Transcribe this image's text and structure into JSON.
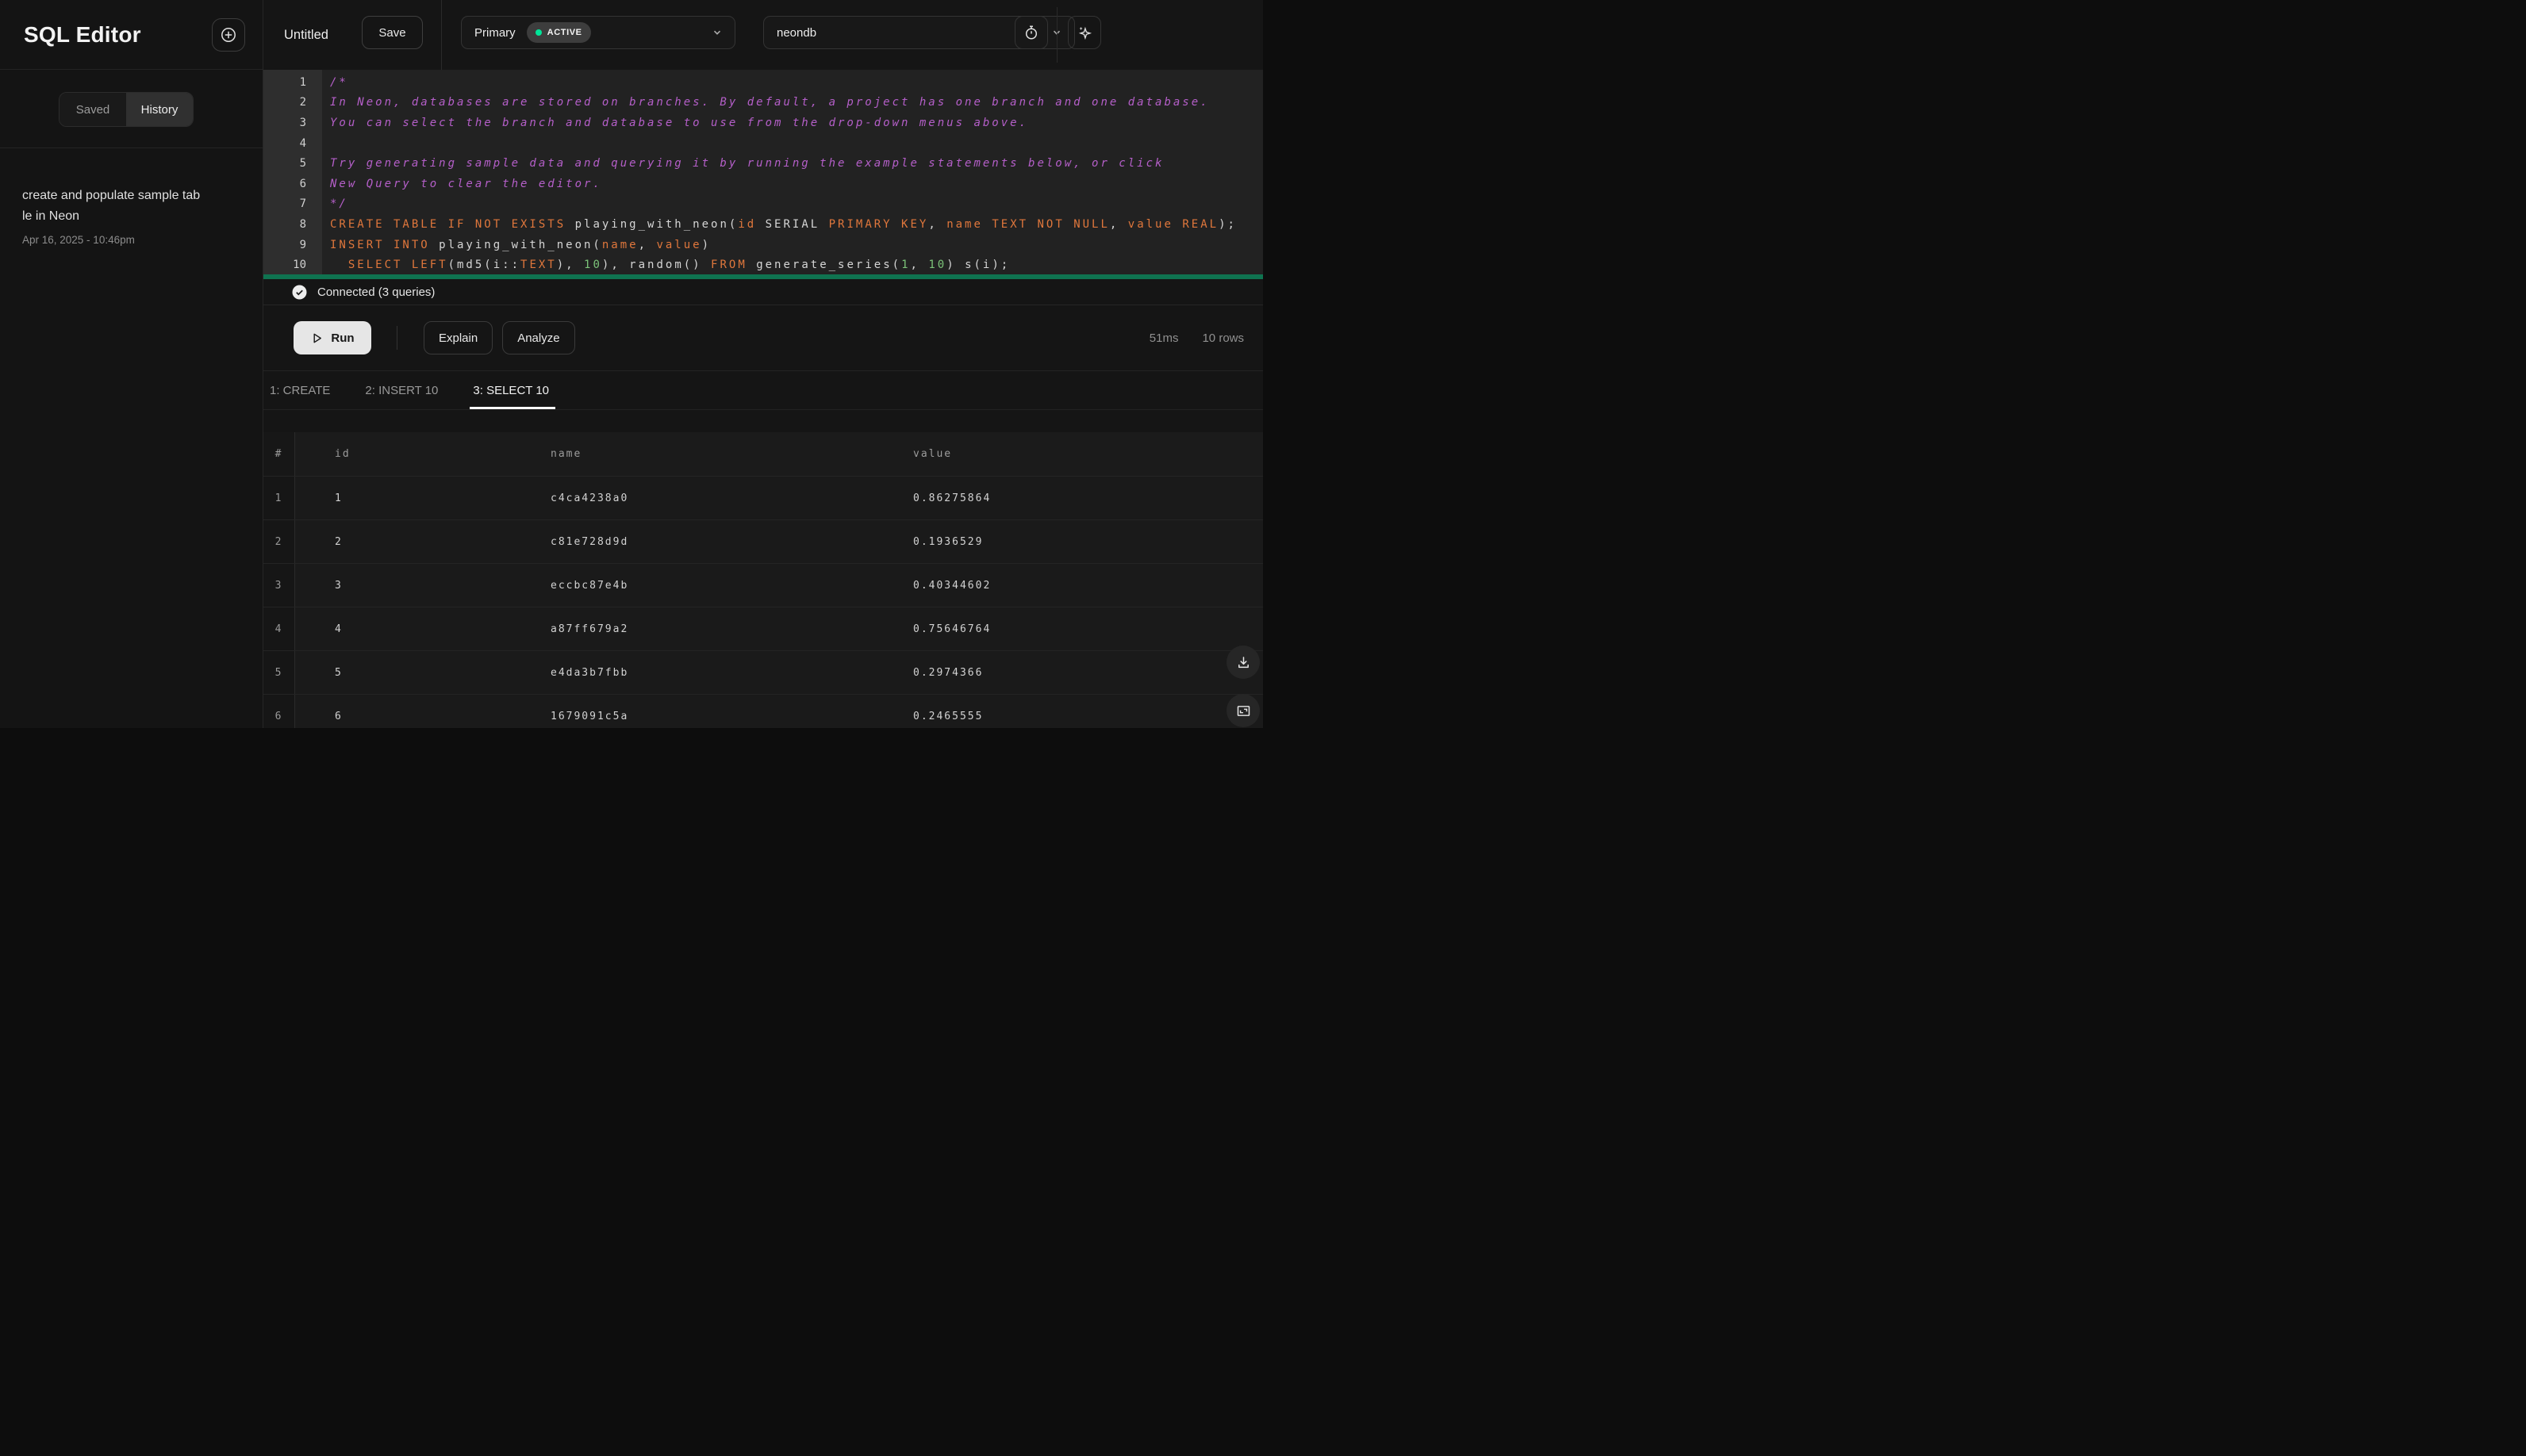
{
  "app": {
    "title": "SQL Editor"
  },
  "sidebar": {
    "tabs": [
      {
        "label": "Saved",
        "active": false
      },
      {
        "label": "History",
        "active": true
      }
    ],
    "history": [
      {
        "title": "create and populate sample table in Neon",
        "date": "Apr 16, 2025 - 10:46pm"
      }
    ]
  },
  "topbar": {
    "query_title": "Untitled",
    "save_label": "Save",
    "branch": {
      "name": "Primary",
      "status_badge": "ACTIVE"
    },
    "database": {
      "name": "neondb"
    }
  },
  "editor": {
    "lines": [
      {
        "n": "1",
        "tokens": [
          [
            "/*",
            "c"
          ]
        ]
      },
      {
        "n": "2",
        "tokens": [
          [
            "In Neon, databases are stored on branches. By default, a project has one branch and one database.",
            "c"
          ]
        ]
      },
      {
        "n": "3",
        "tokens": [
          [
            "You can select the branch and database to use from the drop-down menus above.",
            "c"
          ]
        ]
      },
      {
        "n": "4",
        "tokens": []
      },
      {
        "n": "5",
        "tokens": [
          [
            "Try generating sample data and querying it by running the example statements below, or click",
            "c"
          ]
        ]
      },
      {
        "n": "6",
        "tokens": [
          [
            "New Query to clear the editor.",
            "c"
          ]
        ]
      },
      {
        "n": "7",
        "tokens": [
          [
            "*/",
            "c"
          ]
        ]
      },
      {
        "n": "8",
        "tokens": [
          [
            "CREATE TABLE IF NOT EXISTS",
            "k"
          ],
          [
            " playing_with_neon(",
            "p"
          ],
          [
            "id",
            "k"
          ],
          [
            " SERIAL ",
            "p"
          ],
          [
            "PRIMARY KEY",
            "k"
          ],
          [
            ", ",
            "p"
          ],
          [
            "name TEXT NOT NULL",
            "k"
          ],
          [
            ", ",
            "p"
          ],
          [
            "value REAL",
            "k"
          ],
          [
            ");",
            "p"
          ]
        ]
      },
      {
        "n": "9",
        "tokens": [
          [
            "INSERT INTO",
            "k"
          ],
          [
            " playing_with_neon(",
            "p"
          ],
          [
            "name",
            "k"
          ],
          [
            ", ",
            "p"
          ],
          [
            "value",
            "k"
          ],
          [
            ")",
            "p"
          ]
        ]
      },
      {
        "n": "10",
        "tokens": [
          [
            "  ",
            "p"
          ],
          [
            "SELECT LEFT",
            "k"
          ],
          [
            "(md5(i::",
            "p"
          ],
          [
            "TEXT",
            "k"
          ],
          [
            "), ",
            "p"
          ],
          [
            "10",
            "n"
          ],
          [
            "), random() ",
            "p"
          ],
          [
            "FROM",
            "k"
          ],
          [
            " generate_series(",
            "p"
          ],
          [
            "1",
            "n"
          ],
          [
            ", ",
            "p"
          ],
          [
            "10",
            "n"
          ],
          [
            ") s(i);",
            "p"
          ]
        ]
      }
    ]
  },
  "status": {
    "message": "Connected (3 queries)"
  },
  "toolbar": {
    "run_label": "Run",
    "explain_label": "Explain",
    "analyze_label": "Analyze",
    "duration": "51ms",
    "row_count": "10 rows"
  },
  "results": {
    "tabs": [
      {
        "label": "1: CREATE",
        "active": false
      },
      {
        "label": "2: INSERT 10",
        "active": false
      },
      {
        "label": "3: SELECT 10",
        "active": true
      }
    ],
    "table": {
      "columns": [
        "#",
        "id",
        "name",
        "value"
      ],
      "rows": [
        {
          "num": "1",
          "id": "1",
          "name": "c4ca4238a0",
          "value": "0.86275864"
        },
        {
          "num": "2",
          "id": "2",
          "name": "c81e728d9d",
          "value": "0.1936529"
        },
        {
          "num": "3",
          "id": "3",
          "name": "eccbc87e4b",
          "value": "0.40344602"
        },
        {
          "num": "4",
          "id": "4",
          "name": "a87ff679a2",
          "value": "0.75646764"
        },
        {
          "num": "5",
          "id": "5",
          "name": "e4da3b7fbb",
          "value": "0.2974366"
        },
        {
          "num": "6",
          "id": "6",
          "name": "1679091c5a",
          "value": "0.2465555"
        }
      ]
    }
  },
  "colors": {
    "accent_green": "#00e599",
    "run_button_bg": "#e6e6e6",
    "syntax_comment": "#b55fc9",
    "syntax_keyword": "#e0773c",
    "syntax_number": "#7cc379",
    "selection_bar": "#0f7350"
  }
}
